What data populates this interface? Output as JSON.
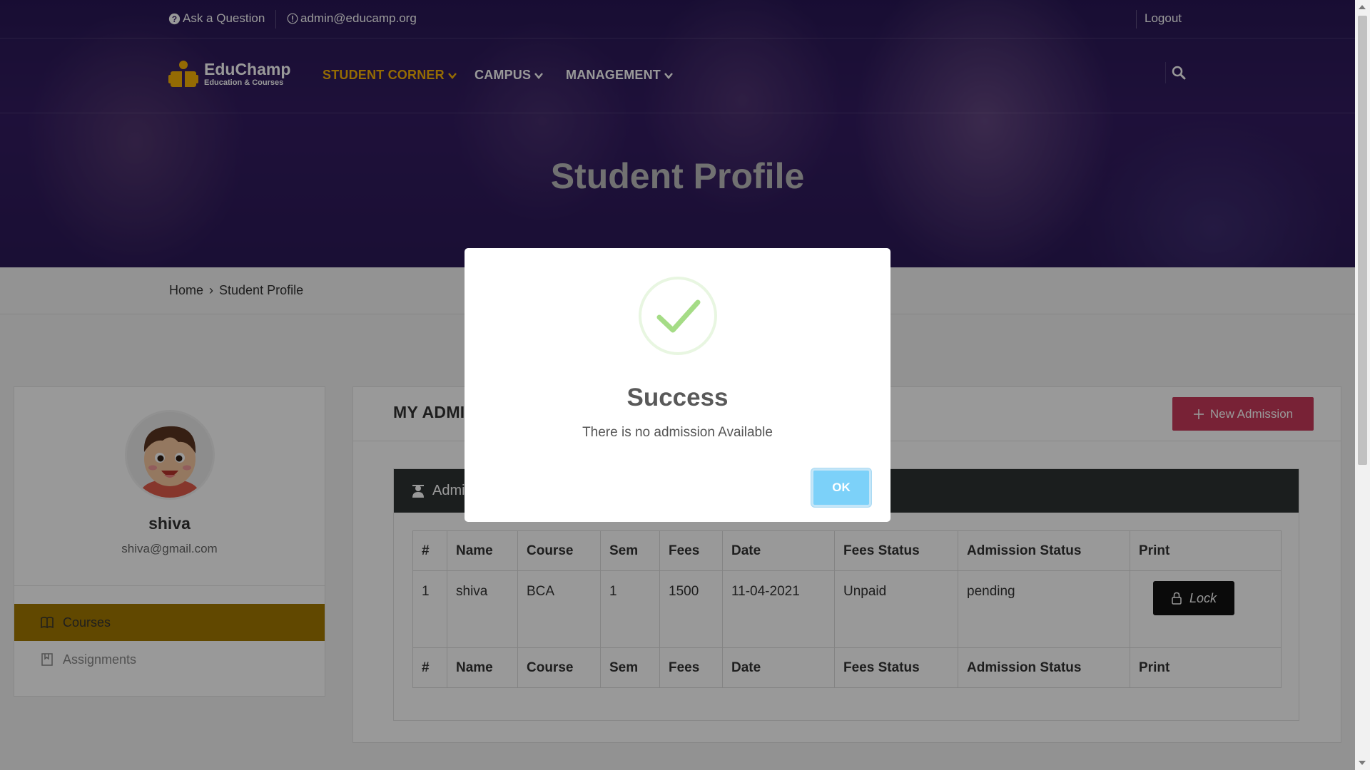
{
  "colors": {
    "accent": "#f7b205",
    "sidebar_active": "#a27800",
    "danger": "#c8395a",
    "ok_button": "#7cd1f9",
    "success_check": "#a5dc86"
  },
  "topbar": {
    "ask_label": "Ask a Question",
    "email_label": "admin@educamp.org",
    "logout_label": "Logout"
  },
  "logo": {
    "brand": "EduChamp",
    "tagline": "Education & Courses"
  },
  "nav": {
    "items": [
      {
        "label": "STUDENT CORNER",
        "icon": "chevron-down-icon"
      },
      {
        "label": "CAMPUS",
        "icon": "chevron-down-icon"
      },
      {
        "label": "MANAGEMENT",
        "icon": "chevron-down-icon"
      }
    ],
    "search_icon": "search-icon"
  },
  "hero": {
    "title": "Student Profile"
  },
  "breadcrumb": {
    "home": "Home",
    "separator": "›",
    "current": "Student Profile"
  },
  "profile": {
    "name": "shiva",
    "email": "shiva@gmail.com",
    "menu": [
      {
        "label": "Courses",
        "icon": "book-icon"
      },
      {
        "label": "Assignments",
        "icon": "bookmark-icon"
      }
    ]
  },
  "main": {
    "title": "MY ADMISSIONS",
    "new_admission_label": "New Admission",
    "table_header": "Admissions",
    "columns": [
      "#",
      "Name",
      "Course",
      "Sem",
      "Fees",
      "Date",
      "Fees Status",
      "Admission Status",
      "Print"
    ],
    "rows": [
      {
        "num": "1",
        "name": "shiva",
        "course": "BCA",
        "sem": "1",
        "fees": "1500",
        "date": "11-04-2021",
        "fees_status": "Unpaid",
        "admission_status": "pending",
        "print_label": "Lock"
      }
    ]
  },
  "modal": {
    "title": "Success",
    "message": "There is no admission Available",
    "ok_label": "OK"
  }
}
